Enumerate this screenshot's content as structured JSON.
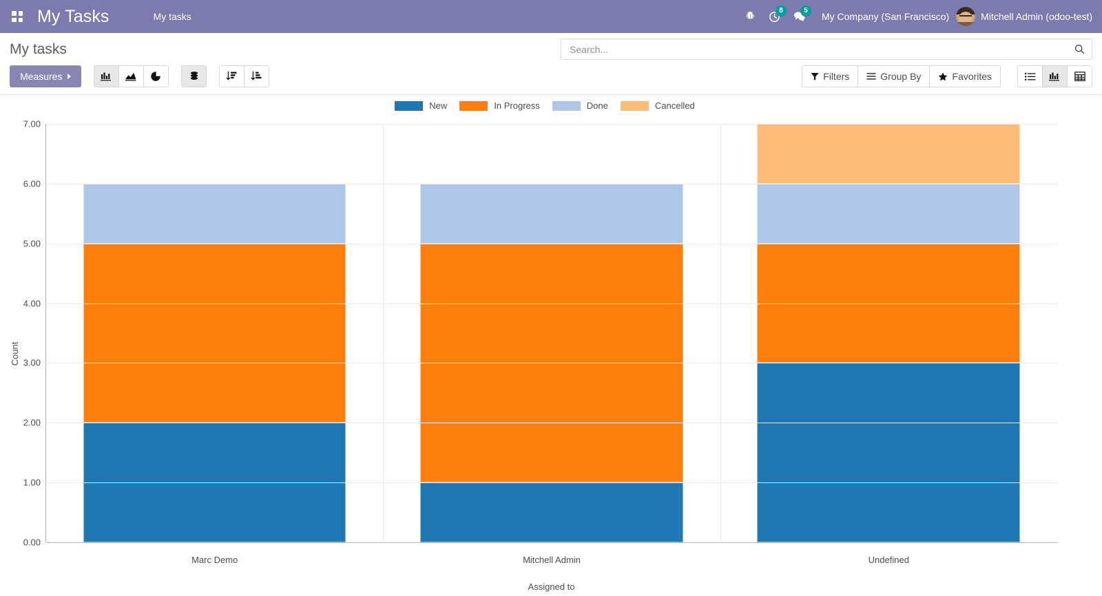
{
  "navbar": {
    "apps_icon": "apps-grid-icon",
    "brand": "My Tasks",
    "menu": "My tasks",
    "bug_icon": "bug-icon",
    "activities": {
      "icon": "clock-icon",
      "count": "8"
    },
    "messages": {
      "icon": "chat-icon",
      "count": "5"
    },
    "company": "My Company (San Francisco)",
    "user": "Mitchell Admin (odoo-test)",
    "avatar": "user-avatar",
    "bg_color": "#7c7bad"
  },
  "control_panel": {
    "breadcrumb": "My tasks",
    "search": {
      "placeholder": "Search...",
      "value": "",
      "icon": "search-icon"
    },
    "measures_label": "Measures",
    "chart_type_buttons": [
      {
        "name": "bar-chart-icon",
        "title": "Bar Chart",
        "active": true
      },
      {
        "name": "line-chart-icon",
        "title": "Line Chart",
        "active": false
      },
      {
        "name": "pie-chart-icon",
        "title": "Pie Chart",
        "active": false
      }
    ],
    "stacked_button": {
      "name": "stacked-icon",
      "title": "Stacked",
      "active": true
    },
    "sort_buttons": [
      {
        "name": "sort-descending-icon",
        "title": "Descending"
      },
      {
        "name": "sort-ascending-icon",
        "title": "Ascending"
      }
    ],
    "filters_label": "Filters",
    "group_by_label": "Group By",
    "favorites_label": "Favorites",
    "view_switcher": [
      {
        "name": "list-view-icon",
        "title": "List",
        "active": false
      },
      {
        "name": "graph-view-icon",
        "title": "Graph",
        "active": true
      },
      {
        "name": "pivot-view-icon",
        "title": "Pivot",
        "active": false
      }
    ]
  },
  "chart_data": {
    "type": "bar",
    "stacked": true,
    "title": "",
    "xlabel": "Assigned to",
    "ylabel": "Count",
    "categories": [
      "Marc Demo",
      "Mitchell Admin",
      "Undefined"
    ],
    "ylim": [
      0,
      7
    ],
    "yticks": [
      "0.00",
      "1.00",
      "2.00",
      "3.00",
      "4.00",
      "5.00",
      "6.00",
      "7.00"
    ],
    "grid": true,
    "legend_position": "top",
    "series": [
      {
        "name": "New",
        "color": "#1f77b4",
        "values": [
          2,
          1,
          3
        ]
      },
      {
        "name": "In Progress",
        "color": "#ff7f0e",
        "values": [
          3,
          4,
          2
        ]
      },
      {
        "name": "Done",
        "color": "#aec7e8",
        "values": [
          1,
          1,
          1
        ]
      },
      {
        "name": "Cancelled",
        "color": "#ffbb78",
        "values": [
          0,
          0,
          1
        ]
      }
    ],
    "totals": [
      6,
      6,
      7
    ]
  }
}
